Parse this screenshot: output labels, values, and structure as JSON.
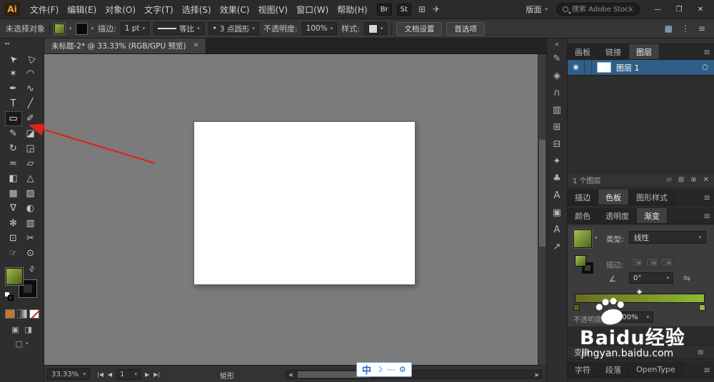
{
  "colors": {
    "accent-blue": "#2f5e86",
    "olive": "#7d9a30",
    "olive-dark": "#4f601d",
    "grad-left": "#6a6a22",
    "grad-right": "#8cba33",
    "canvas-gray": "#7b7b7b",
    "arrow_red": "#dd2418",
    "ime_blue": "#1b66c9"
  },
  "ui": {
    "caret": "▾"
  },
  "titlebar": {
    "logo": "Ai",
    "menus": [
      "文件(F)",
      "编辑(E)",
      "对象(O)",
      "文字(T)",
      "选择(S)",
      "效果(C)",
      "视图(V)",
      "窗口(W)",
      "帮助(H)"
    ],
    "bridge": "Br",
    "stock": "St",
    "arrange_icon": "⊞",
    "share_icon": "✈",
    "workspace": "版面",
    "search_placeholder": "搜索 Adobe Stock",
    "minimize": "—",
    "maximize": "❐",
    "close": "✕"
  },
  "controlbar": {
    "selection_status": "未选择对象",
    "stroke_label": "描边:",
    "stroke_width": "1 pt",
    "profile_value": "等比",
    "brush_dot": "•",
    "brush_value": "3 点圆形",
    "opacity_label": "不透明度:",
    "opacity_value": "100%",
    "style_label": "样式:",
    "doc_setup_button": "文档设置",
    "preferences_button": "首选项",
    "right_icons": [
      {
        "name": "workspace-grid-icon",
        "glyph": "▦"
      },
      {
        "name": "dock-columns-icon",
        "glyph": "⋮"
      },
      {
        "name": "control-menu-icon",
        "glyph": "≡"
      }
    ]
  },
  "toolbar": {
    "collapse_icon": "◂◂",
    "tools": [
      {
        "name": "selection-tool",
        "glyph": "➤",
        "cls": "rot-ul"
      },
      {
        "name": "direct-selection-tool",
        "glyph": "▷",
        "cls": "rot-ul"
      },
      {
        "name": "magic-wand-tool",
        "glyph": "✶"
      },
      {
        "name": "lasso-tool",
        "glyph": "◠"
      },
      {
        "name": "pen-tool",
        "glyph": "✒"
      },
      {
        "name": "curvature-tool",
        "glyph": "∿"
      },
      {
        "name": "type-tool",
        "glyph": "T"
      },
      {
        "name": "line-segment-tool",
        "glyph": "╱"
      },
      {
        "name": "rectangle-tool",
        "glyph": "▭",
        "active": true
      },
      {
        "name": "paintbrush-tool",
        "glyph": "✐"
      },
      {
        "name": "pencil-tool",
        "glyph": "✎"
      },
      {
        "name": "eraser-tool",
        "glyph": "◪"
      },
      {
        "name": "rotate-tool",
        "glyph": "↻"
      },
      {
        "name": "scale-tool",
        "glyph": "◲"
      },
      {
        "name": "width-tool",
        "glyph": "≈"
      },
      {
        "name": "free-transform-tool",
        "glyph": "▱"
      },
      {
        "name": "shape-builder-tool",
        "glyph": "◧"
      },
      {
        "name": "perspective-grid-tool",
        "glyph": "△"
      },
      {
        "name": "mesh-tool",
        "glyph": "▦"
      },
      {
        "name": "gradient-tool",
        "glyph": "▨"
      },
      {
        "name": "eyedropper-tool",
        "glyph": "∇"
      },
      {
        "name": "blend-tool",
        "glyph": "◐"
      },
      {
        "name": "symbol-sprayer-tool",
        "glyph": "✻"
      },
      {
        "name": "column-graph-tool",
        "glyph": "▥"
      },
      {
        "name": "artboard-tool",
        "glyph": "⊡"
      },
      {
        "name": "slice-tool",
        "glyph": "✂"
      },
      {
        "name": "hand-tool",
        "glyph": "☞"
      },
      {
        "name": "zoom-tool",
        "glyph": "⊙"
      }
    ],
    "swap_icon": "⇄",
    "draw_normal_icon": "▣",
    "draw_behind_icon": "◨",
    "screen_icon": "▢"
  },
  "tabbar": {
    "title": "未标题-2* @ 33.33% (RGB/GPU 预览)",
    "close_icon": "✕"
  },
  "ime": {
    "lang": "中",
    "moon": "☽",
    "dots": "⋯",
    "gear": "⚙"
  },
  "statusbar": {
    "zoom": "33.33%",
    "nav_first": "|◀",
    "nav_prev": "◀",
    "artboard": "1",
    "nav_next": "▶",
    "nav_last": "▶|",
    "tool": "矩形",
    "scroll_left": "◀",
    "scroll_right": "▶"
  },
  "dock": {
    "expand_icon": "«",
    "icons": [
      {
        "name": "pencil-icon",
        "glyph": "✎"
      },
      {
        "name": "compass-icon",
        "glyph": "◈"
      },
      {
        "name": "magnet-icon",
        "glyph": "∩"
      },
      {
        "name": "bar-chart-icon",
        "glyph": "▥"
      },
      {
        "name": "layers-stack-icon",
        "glyph": "⊞"
      },
      {
        "name": "libraries-icon",
        "glyph": "⊟"
      },
      {
        "name": "sparkle-icon",
        "glyph": "✦"
      },
      {
        "name": "club-symbol-icon",
        "glyph": "♣"
      },
      {
        "name": "character-styles-icon",
        "glyph": "A"
      },
      {
        "name": "image-panel-icon",
        "glyph": "▣"
      },
      {
        "name": "character-icon",
        "glyph": "A"
      },
      {
        "name": "export-arrow-icon",
        "glyph": "↗"
      }
    ]
  },
  "panels": {
    "group1_tabs": [
      {
        "label": "画板",
        "name": "tab-artboards"
      },
      {
        "label": "链接",
        "name": "tab-links"
      },
      {
        "label": "图层",
        "name": "tab-layers",
        "active": true
      }
    ],
    "layers": {
      "eye_icon": "◉",
      "rows": [
        {
          "label": "图层 1"
        }
      ],
      "target_icon": "○",
      "status": "1 个图层",
      "footer_icons": [
        {
          "name": "clipping-mask-icon",
          "glyph": "▱"
        },
        {
          "name": "new-sublayer-icon",
          "glyph": "⊞"
        },
        {
          "name": "new-layer-icon",
          "glyph": "⊕"
        },
        {
          "name": "delete-layer-icon",
          "glyph": "✕"
        }
      ]
    },
    "group2_tabs": [
      {
        "label": "描边",
        "name": "tab-stroke"
      },
      {
        "label": "色板",
        "name": "tab-swatches",
        "active": true
      },
      {
        "label": "图形样式",
        "name": "tab-graphic-styles"
      }
    ],
    "group3_tabs": [
      {
        "label": "颜色",
        "name": "tab-color"
      },
      {
        "label": "透明度",
        "name": "tab-transparency"
      },
      {
        "label": "渐变",
        "name": "tab-gradient",
        "active": true
      }
    ],
    "menu_icon": "≡",
    "gradient": {
      "type_label": "类型:",
      "type_value": "线性",
      "stroke_label": "描边:",
      "angle_icon": "∠",
      "angle_value": "0°",
      "reverse_icon": "⇋",
      "opacity_label": "不透明度:",
      "opacity_value": "100%"
    },
    "transform_label": "变换",
    "bottom_tabs": [
      {
        "label": "字符",
        "name": "tab-character"
      },
      {
        "label": "段落",
        "name": "tab-paragraph"
      },
      {
        "label": "OpenType",
        "name": "tab-opentype"
      }
    ]
  },
  "watermark": {
    "brand_en": "Baidu",
    "brand_cn": "经验",
    "url": "jingyan.baidu.com"
  }
}
